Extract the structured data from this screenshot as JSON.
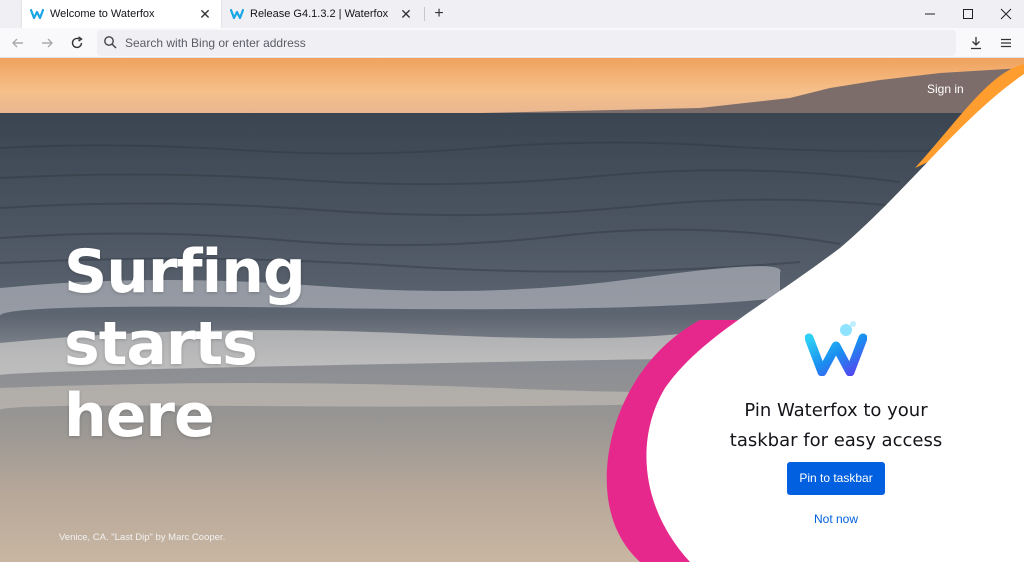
{
  "tabs": [
    {
      "label": "Welcome to Waterfox",
      "active": true
    },
    {
      "label": "Release G4.1.3.2 | Waterfox",
      "active": false
    }
  ],
  "toolbar": {
    "url_placeholder": "Search with Bing or enter address"
  },
  "page": {
    "sign_in": "Sign in",
    "hero_line1": "Surfing",
    "hero_line2": "starts",
    "hero_line3": "here",
    "photo_credit": "Venice, CA. \"Last Dip\" by Marc Cooper.",
    "pin_line1": "Pin Waterfox to your",
    "pin_line2": "taskbar for easy access",
    "pin_button": "Pin to taskbar",
    "not_now": "Not now"
  },
  "icons": {
    "tab1": "waterfox-logo-icon",
    "tab2": "waterfox-logo-icon",
    "close": "close-icon",
    "new_tab": "plus-icon",
    "back": "back-arrow-icon",
    "forward": "forward-arrow-icon",
    "reload": "reload-icon",
    "search": "search-icon",
    "downloads": "download-icon",
    "menu": "hamburger-menu-icon",
    "minimize": "minimize-icon",
    "maximize": "maximize-icon",
    "window_close": "window-close-icon"
  },
  "colors": {
    "accent_blue": "#0060df",
    "magenta": "#e6288c",
    "orange": "#ff9d2e"
  }
}
